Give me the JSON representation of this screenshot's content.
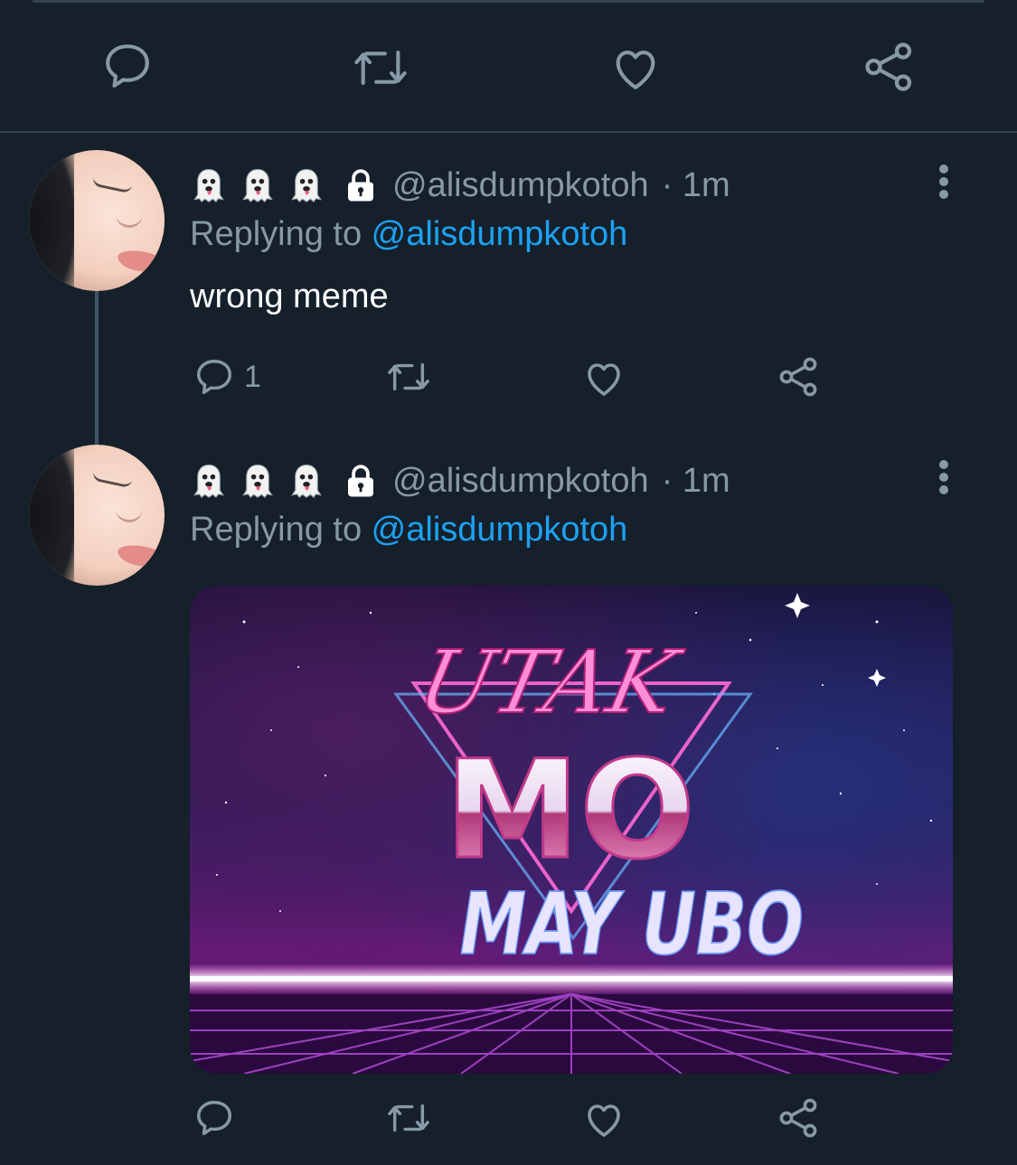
{
  "top_actions": {
    "reply_icon": "reply-icon",
    "retweet_icon": "retweet-icon",
    "like_icon": "like-icon",
    "share_icon": "share-icon"
  },
  "tweets": [
    {
      "display_emojis": [
        "ghost",
        "ghost",
        "ghost"
      ],
      "locked": true,
      "handle": "@alisdumpkotoh",
      "time": "· 1m",
      "replying_prefix": "Replying to ",
      "replying_to": "@alisdumpkotoh",
      "text": "wrong meme",
      "reply_count": "1"
    },
    {
      "display_emojis": [
        "ghost",
        "ghost",
        "ghost"
      ],
      "locked": true,
      "handle": "@alisdumpkotoh",
      "time": "· 1m",
      "replying_prefix": "Replying to ",
      "replying_to": "@alisdumpkotoh",
      "media": {
        "line1": "UTAK",
        "line2": "MO",
        "line3": "MAY UBO"
      },
      "reply_count": ""
    }
  ],
  "colors": {
    "background": "#15202b",
    "muted": "#8899a6",
    "mention": "#1da1f2",
    "divider": "#38444d"
  }
}
